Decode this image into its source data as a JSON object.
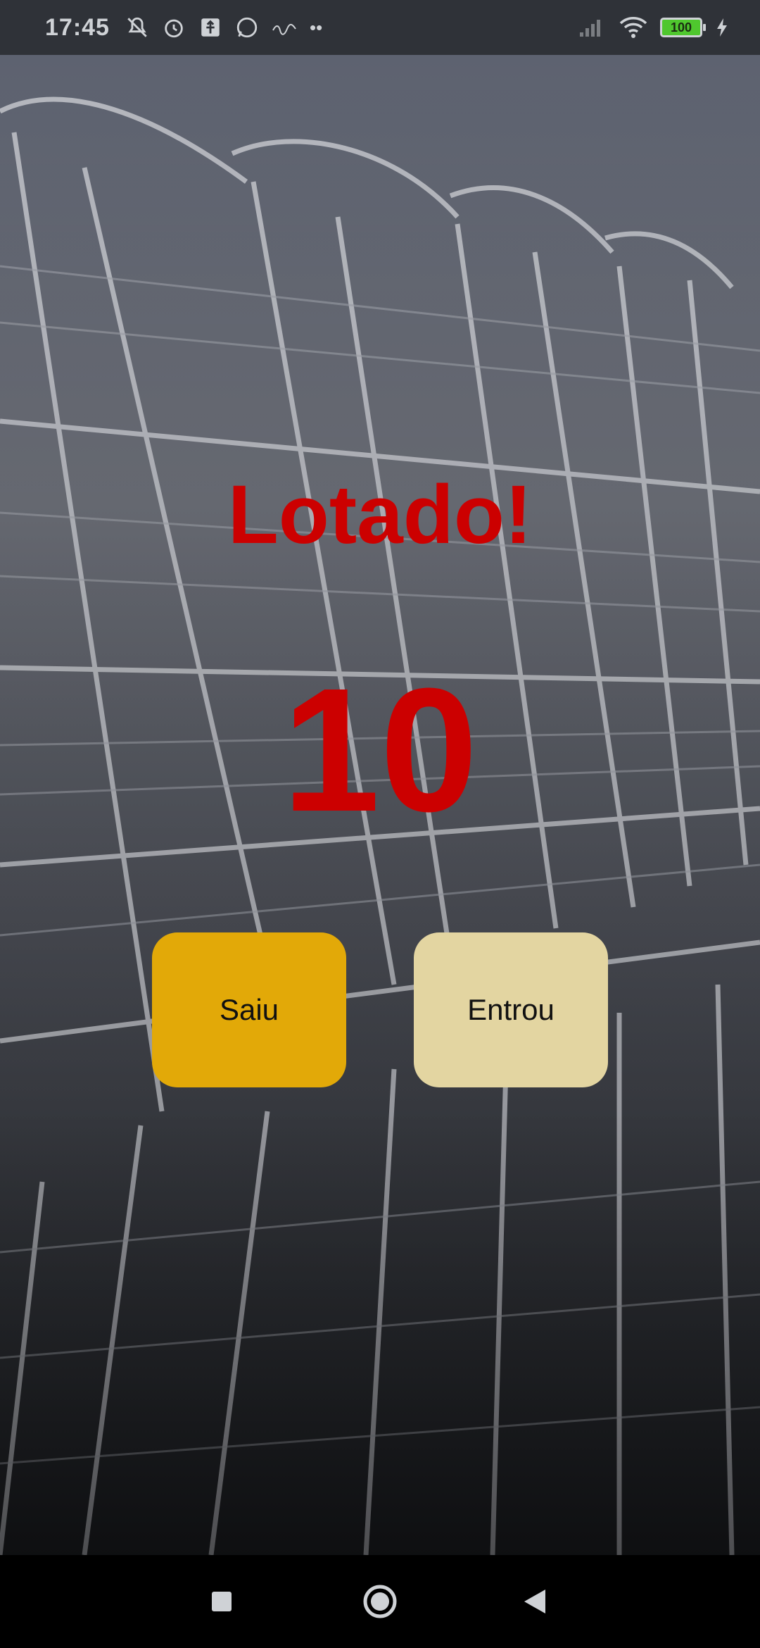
{
  "status_bar": {
    "time": "17:45",
    "left_icons": [
      "muted-bell-icon",
      "alarm-icon",
      "usb-debug-icon",
      "whatsapp-icon",
      "illegal-icon"
    ],
    "dots": "••",
    "right_icons": [
      "signal-icon",
      "wifi-icon",
      "battery-icon",
      "charging-icon"
    ],
    "battery_level": "100"
  },
  "main": {
    "status_text": "Lotado!",
    "count": "10",
    "exit_button_label": "Saiu",
    "enter_button_label": "Entrou"
  },
  "colors": {
    "accent_red": "#cc0000",
    "exit_button": "#e2a908",
    "enter_button": "#e3d5a1"
  },
  "nav_bar": {
    "icons": [
      "recents-square-icon",
      "home-circle-icon",
      "back-triangle-icon"
    ]
  }
}
